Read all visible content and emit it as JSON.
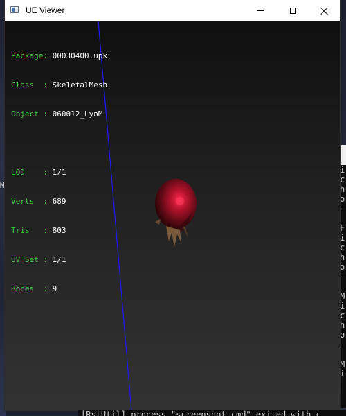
{
  "window": {
    "title": "UE Viewer",
    "buttons": {
      "minimize": "minimize",
      "maximize": "maximize",
      "close": "close"
    }
  },
  "info": {
    "package": {
      "label": "Package:",
      "value": "00030400.upk"
    },
    "class": {
      "label": "Class  :",
      "value": "SkeletalMesh"
    },
    "object": {
      "label": "Object :",
      "value": "060012_LynM"
    },
    "lod": {
      "label": "LOD    :",
      "value": "1/1"
    },
    "verts": {
      "label": "Verts  :",
      "value": "689"
    },
    "tris": {
      "label": "Tris   :",
      "value": "803"
    },
    "uvset": {
      "label": "UV Set :",
      "value": "1/1"
    },
    "bones": {
      "label": "Bones  :",
      "value": "9"
    }
  },
  "background": {
    "left_glyph": "M",
    "side_console_lines": [
      "i",
      "c",
      "h",
      "o",
      "-",
      "F",
      "i",
      "c",
      "h",
      "o",
      "-",
      "M",
      "i",
      "c",
      "h",
      "o",
      "-",
      "M",
      "i"
    ],
    "bottom_console_text": "[RstUtil] process \"screenshot_cmd\" exited with c"
  },
  "colors": {
    "label_green": "#3fd23f",
    "value_white": "#ffffff",
    "axis_blue": "#1a1aff",
    "mesh_red": "#8a0f1e"
  },
  "icons": {
    "app": "window-app-icon",
    "minimize": "minimize-icon",
    "maximize": "maximize-icon",
    "close": "close-icon"
  }
}
